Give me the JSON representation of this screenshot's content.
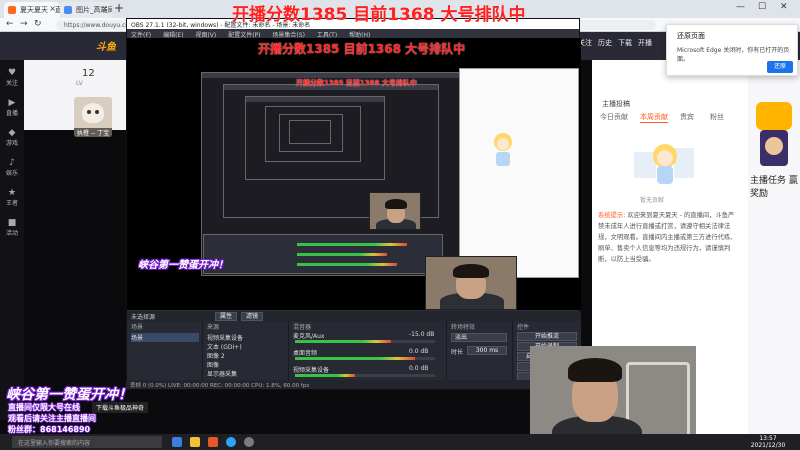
{
  "browser": {
    "tab1": "夏天夏天 - 直播_高端局圆刷·斗鱼直播",
    "tab2": "图片_高端局圆刷·高端局圆刷视频",
    "tab1_close": "×",
    "tab2_close": "×",
    "new_tab": "+",
    "url": "https://www.douyu.com/",
    "back": "←",
    "forward": "→",
    "refresh": "↻",
    "minimize": "—",
    "maximize": "☐",
    "close": "✕"
  },
  "douyu": {
    "logo": "斗鱼",
    "top_menu": [
      "关注",
      "历史",
      "下载",
      "开播",
      "客户端",
      "充值"
    ],
    "left_nav": [
      {
        "icon": "♥",
        "label": "关注"
      },
      {
        "icon": "▶",
        "label": "直播"
      },
      {
        "icon": "◆",
        "label": "游戏"
      },
      {
        "icon": "♪",
        "label": "娱乐"
      },
      {
        "icon": "★",
        "label": "王者"
      },
      {
        "icon": "■",
        "label": "活动"
      }
    ],
    "level": "12",
    "level_sub": "LV",
    "avatar_caption": "执橙 -- 丁宝",
    "avatar_caption2": "执橙"
  },
  "right_panel": {
    "host": "主播投稿",
    "tabs": [
      "今日贡献",
      "本周贡献",
      "贵宾",
      "粉丝"
    ],
    "illus_caption": "暂无贡献",
    "system_tag": "系统提示:",
    "system_text": "欢迎来到夏天夏天 - 的直播间，斗鱼严禁未成年人进行直播或打赏，请遵守相关法律法规，文明观看。直播间内主播或第三方进行代练、刷单、售卖个人信息等均为违规行为，请谨慎判断，以防上当受骗。",
    "side_title": "主播任务 赢奖励"
  },
  "edge_popup": {
    "title": "还原页面",
    "body": "Microsoft Edge 关闭时，你有已打开的页面。",
    "button": "还原"
  },
  "obs": {
    "title": "OBS 27.1.1 (32-bit, windows) - 配置文件: 未命名 - 场景: 未命名",
    "menu": [
      "文件(F)",
      "编辑(E)",
      "视图(V)",
      "配置文件(P)",
      "场景集合(S)",
      "工具(T)",
      "帮助(H)"
    ],
    "preview_label": "未选择源",
    "props_button": "属性",
    "filter_button": "滤镜",
    "dock_scenes": "场景",
    "dock_sources": "来源",
    "dock_mixer": "混音器",
    "dock_transitions": "转场特效",
    "dock_controls": "控件",
    "scene_item": "场景",
    "sources": [
      "视频采集设备",
      "文本 (GDI+)",
      "图像 2",
      "图像",
      "显示器采集"
    ],
    "mixer": [
      {
        "name": "麦克风/Aux",
        "db": "-15.0 dB"
      },
      {
        "name": "桌面音频",
        "db": "0.0 dB"
      },
      {
        "name": "视频采集设备",
        "db": "0.0 dB"
      }
    ],
    "transition_type": "淡出",
    "duration_label": "时长",
    "duration_value": "300 ms",
    "controls": [
      "开始推流",
      "开始录制",
      "启动虚拟摄像机",
      "工作室模式",
      "设置",
      "退出"
    ],
    "status": "丢帧 0 (0.0%)   LIVE: 00:00:00   REC: 00:00:00   CPU: 1.8%, 60.00 fps"
  },
  "overlays": {
    "big_red": "开播分数1385   目前1368   大号排队中",
    "mid_red": "开播分数1385   目前1368   大号排队中",
    "small_red": "开播分数1385  目前1368 大号排队中",
    "gift_mid": "峡谷第一赞蛋开冲！",
    "gift_big": "峡谷第一赞蛋开冲！",
    "bl_line1": "直播间仅限大号在线",
    "bl_line2": "观看后请关注主播直播间",
    "bl_line3": "粉丝群：868146890",
    "tip": "下载斗鱼极品神奇"
  },
  "taskbar": {
    "search": "在这里输入你要搜索的内容",
    "time": "13:57",
    "date": "2021/12/30"
  }
}
